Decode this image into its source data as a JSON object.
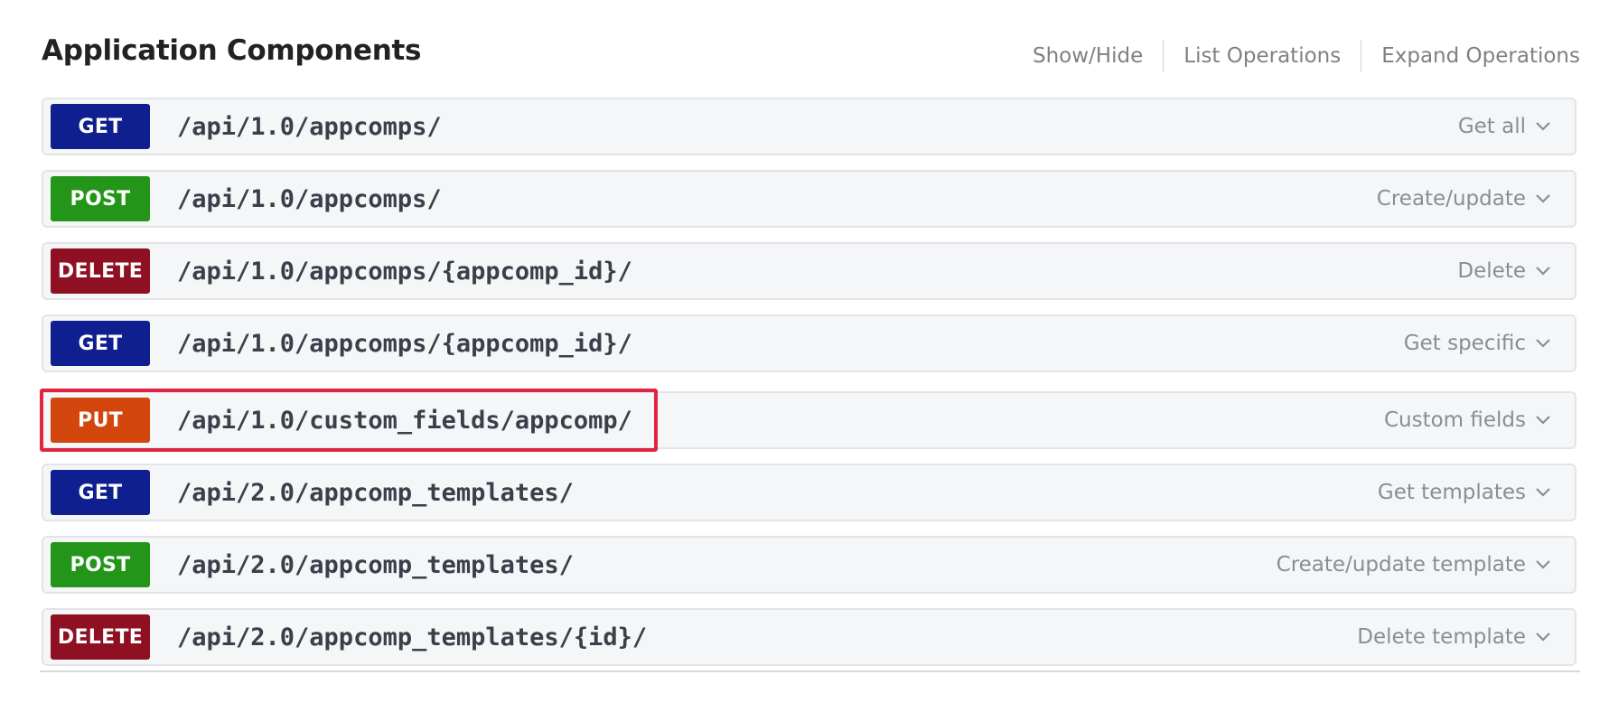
{
  "section": {
    "title": "Application Components",
    "links": [
      "Show/Hide",
      "List Operations",
      "Expand Operations"
    ]
  },
  "operations": [
    {
      "method": "GET",
      "color": "#0f1f8f",
      "path": "/api/1.0/appcomps/",
      "summary": "Get all"
    },
    {
      "method": "POST",
      "color": "#23961a",
      "path": "/api/1.0/appcomps/",
      "summary": "Create/update"
    },
    {
      "method": "DELETE",
      "color": "#8f1022",
      "path": "/api/1.0/appcomps/{appcomp_id}/",
      "summary": "Delete"
    },
    {
      "method": "GET",
      "color": "#0f1f8f",
      "path": "/api/1.0/appcomps/{appcomp_id}/",
      "summary": "Get specific"
    },
    {
      "method": "PUT",
      "color": "#d3470e",
      "path": "/api/1.0/custom_fields/appcomp/",
      "summary": "Custom fields"
    },
    {
      "method": "GET",
      "color": "#0f1f8f",
      "path": "/api/2.0/appcomp_templates/",
      "summary": "Get templates"
    },
    {
      "method": "POST",
      "color": "#23961a",
      "path": "/api/2.0/appcomp_templates/",
      "summary": "Create/update template"
    },
    {
      "method": "DELETE",
      "color": "#8f1022",
      "path": "/api/2.0/appcomp_templates/{id}/",
      "summary": "Delete template"
    }
  ],
  "highlight_color": "#e02441"
}
